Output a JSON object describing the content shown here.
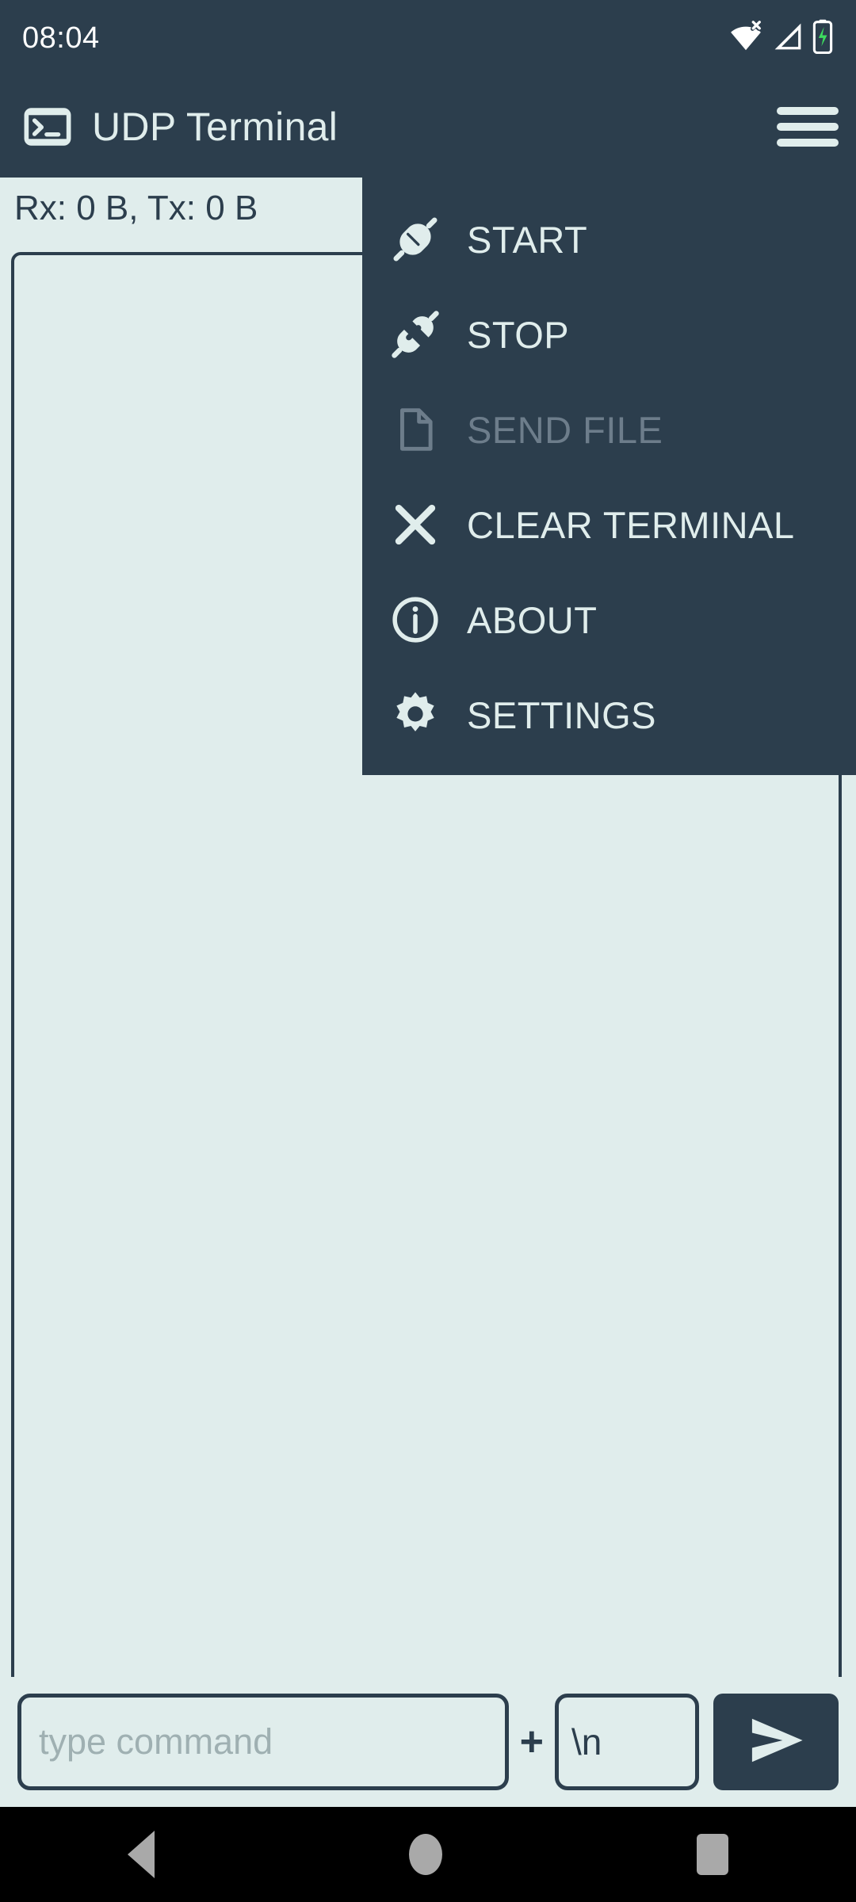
{
  "status_bar": {
    "time": "08:04",
    "icons": [
      "wifi-off-icon",
      "cellular-signal-icon",
      "battery-charging-icon"
    ]
  },
  "app_bar": {
    "icon": "terminal-icon",
    "title": "UDP Terminal",
    "menu_icon": "hamburger-menu-icon"
  },
  "main": {
    "stats": "Rx: 0 B, Tx: 0 B",
    "terminal_output": ""
  },
  "menu": {
    "items": [
      {
        "label": "START",
        "icon": "plug-connected-icon",
        "enabled": true
      },
      {
        "label": "STOP",
        "icon": "plug-disconnected-icon",
        "enabled": true
      },
      {
        "label": "SEND FILE",
        "icon": "file-icon",
        "enabled": false
      },
      {
        "label": "CLEAR TERMINAL",
        "icon": "close-x-icon",
        "enabled": true
      },
      {
        "label": "ABOUT",
        "icon": "info-circle-icon",
        "enabled": true
      },
      {
        "label": "SETTINGS",
        "icon": "gear-icon",
        "enabled": true
      }
    ]
  },
  "input_bar": {
    "command_placeholder": "type command",
    "command_value": "",
    "separator": "+",
    "eol_value": "\\n",
    "send_icon": "send-arrow-icon"
  },
  "nav_bar": {
    "back": "back-icon",
    "home": "home-icon",
    "recents": "recents-icon"
  },
  "colors": {
    "primary_dark": "#2c3e4d",
    "surface_light": "#e0edec",
    "disabled_text": "#6d7d8b",
    "placeholder_text": "#9fb0b2",
    "battery_green": "#3ddc5f"
  }
}
